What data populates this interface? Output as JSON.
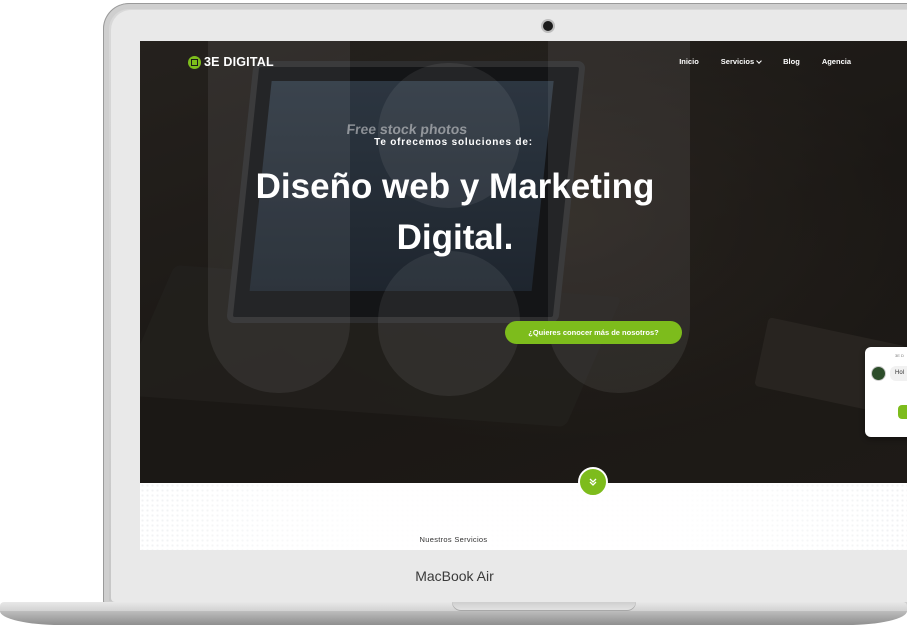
{
  "device": {
    "model_label": "MacBook Air"
  },
  "navbar": {
    "logo_text": "3E DIGITAL",
    "items": [
      {
        "label": "Inicio"
      },
      {
        "label": "Servicios"
      },
      {
        "label": "Blog"
      },
      {
        "label": "Agencia"
      }
    ]
  },
  "hero": {
    "photo_text": "Free stock photos",
    "subtitle": "Te ofrecemos soluciones de:",
    "title_line1": "Diseño web y Marketing",
    "title_line2": "Digital.",
    "cta_label": "¿Quieres conocer más de nosotros?"
  },
  "chat_widget": {
    "title": "3E D",
    "message_preview": "Hol",
    "footer": ""
  },
  "section": {
    "label": "Nuestros Servicios"
  },
  "colors": {
    "accent": "#7dbc1c",
    "hero_bg": "#2b2622",
    "text_light": "#ffffff"
  }
}
